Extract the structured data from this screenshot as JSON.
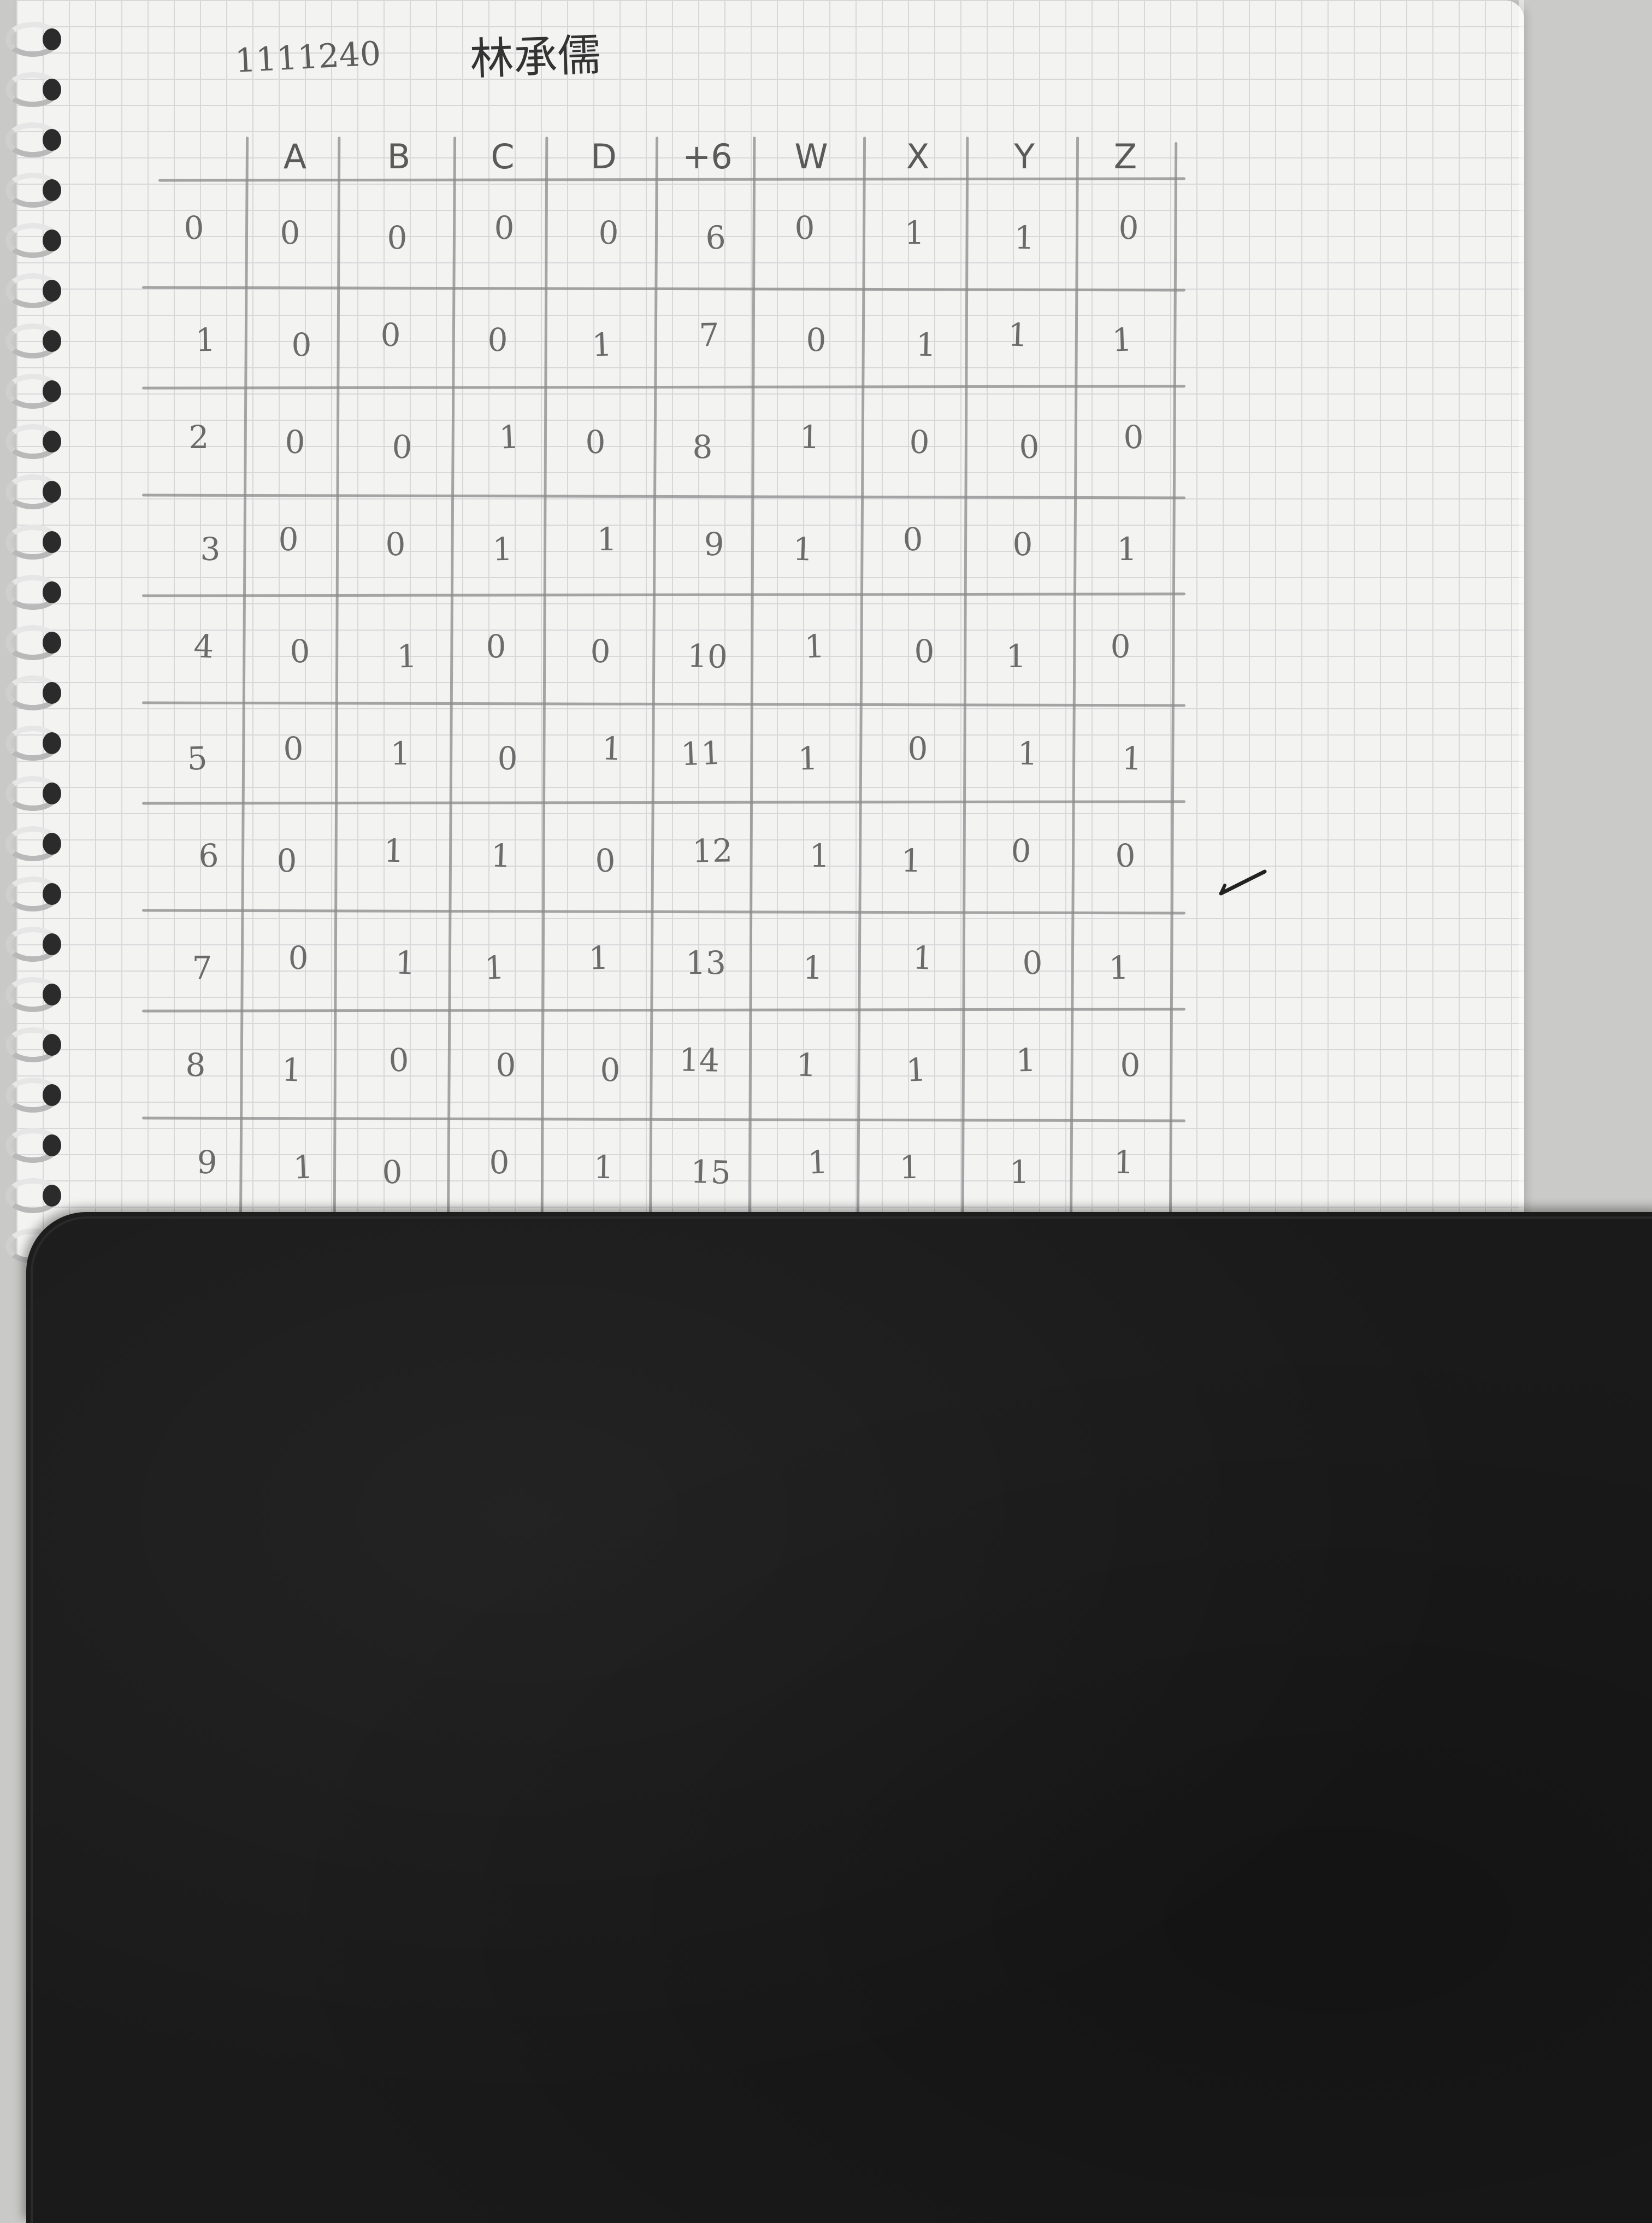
{
  "header": {
    "student_id": "1111240",
    "name": "林承儒"
  },
  "table": {
    "columns": [
      "",
      "A",
      "B",
      "C",
      "D",
      "+6",
      "W",
      "X",
      "Y",
      "Z"
    ],
    "rows": [
      [
        "0",
        "0",
        "0",
        "0",
        "0",
        "6",
        "0",
        "1",
        "1",
        "0"
      ],
      [
        "1",
        "0",
        "0",
        "0",
        "1",
        "7",
        "0",
        "1",
        "1",
        "1"
      ],
      [
        "2",
        "0",
        "0",
        "1",
        "0",
        "8",
        "1",
        "0",
        "0",
        "0"
      ],
      [
        "3",
        "0",
        "0",
        "1",
        "1",
        "9",
        "1",
        "0",
        "0",
        "1"
      ],
      [
        "4",
        "0",
        "1",
        "0",
        "0",
        "10",
        "1",
        "0",
        "1",
        "0"
      ],
      [
        "5",
        "0",
        "1",
        "0",
        "1",
        "11",
        "1",
        "0",
        "1",
        "1"
      ],
      [
        "6",
        "0",
        "1",
        "1",
        "0",
        "12",
        "1",
        "1",
        "0",
        "0"
      ],
      [
        "7",
        "0",
        "1",
        "1",
        "1",
        "13",
        "1",
        "1",
        "0",
        "1"
      ],
      [
        "8",
        "1",
        "0",
        "0",
        "0",
        "14",
        "1",
        "1",
        "1",
        "0"
      ],
      [
        "9",
        "1",
        "0",
        "0",
        "1",
        "15",
        "1",
        "1",
        "1",
        "1"
      ]
    ]
  },
  "colors": {
    "paper": "#f3f3f1",
    "grid": "#d6d8da",
    "pencil": "#6b6b6b",
    "mousepad": "#1a1a1a",
    "desk": "#c9c9c7"
  }
}
